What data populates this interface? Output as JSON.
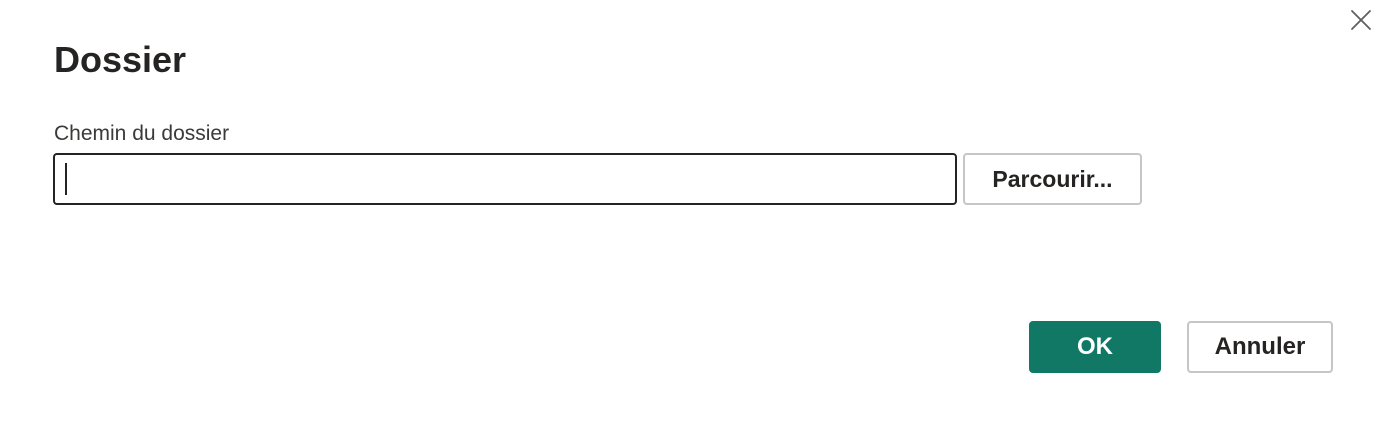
{
  "dialog": {
    "title": "Dossier",
    "close_icon": "close-icon"
  },
  "folder_path": {
    "label": "Chemin du dossier",
    "value": "",
    "placeholder": ""
  },
  "buttons": {
    "browse_label": "Parcourir...",
    "ok_label": "OK",
    "cancel_label": "Annuler"
  },
  "colors": {
    "primary": "#117865",
    "text": "#252423",
    "border": "#c8c6c4"
  }
}
